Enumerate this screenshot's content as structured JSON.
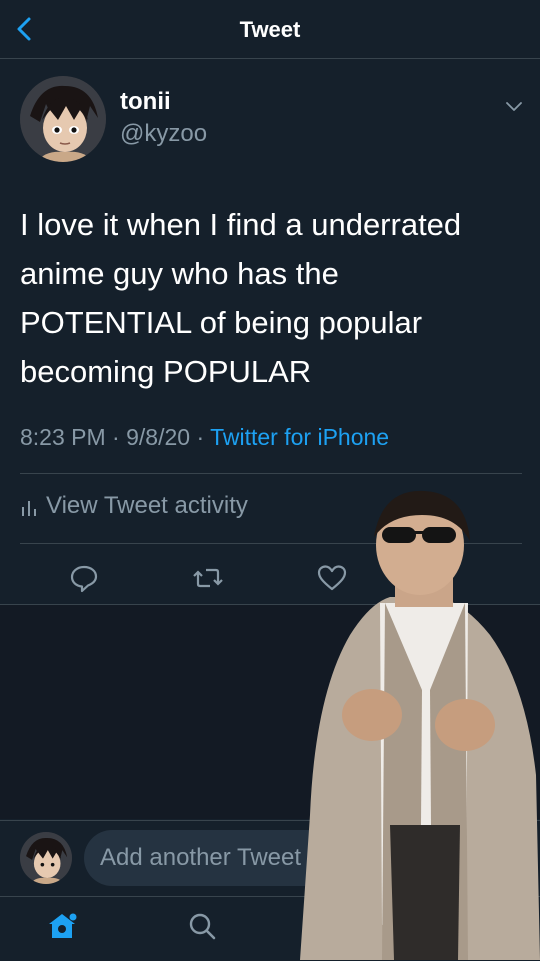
{
  "header": {
    "title": "Tweet",
    "back_icon": "chevron-left-icon"
  },
  "tweet": {
    "display_name": "tonii",
    "handle": "@kyzoo",
    "lines": [
      "I love it when I find a underrated",
      "anime guy who has the",
      "POTENTIAL of being popular",
      "becoming POPULAR"
    ],
    "time": "8:23 PM",
    "date": "9/8/20",
    "separator": "·",
    "source": "Twitter for iPhone"
  },
  "activity": {
    "label": "View Tweet activity"
  },
  "actions": [
    "reply-icon",
    "retweet-icon",
    "like-icon"
  ],
  "compose": {
    "placeholder": "Add another Tweet"
  },
  "tabs": [
    "home-icon",
    "search-icon"
  ],
  "colors": {
    "background": "#15202b",
    "accent": "#1da1f2",
    "muted": "#8899a6",
    "divider": "#38444d"
  }
}
